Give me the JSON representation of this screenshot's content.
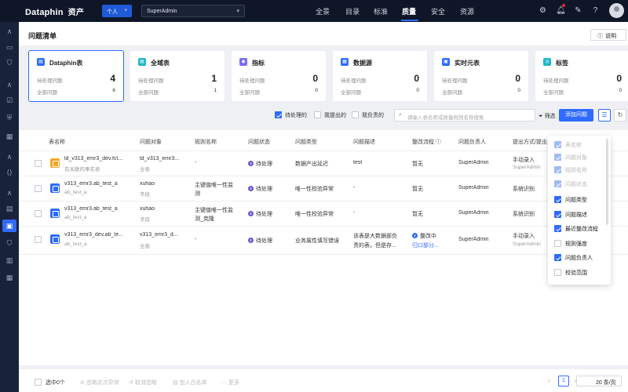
{
  "topbar": {
    "logo": "Dataphin",
    "logo_sub": "资产",
    "mode": "个人",
    "user_select": "SuperAdmin",
    "nav": [
      "全景",
      "目录",
      "标准",
      "质量",
      "安全",
      "资源"
    ],
    "active_nav": "质量"
  },
  "page": {
    "title": "问题清单",
    "help": "说明"
  },
  "cards": [
    {
      "name": "Dataphin表",
      "pending_label": "待处理问题",
      "pending": "4",
      "total_label": "全部问题",
      "total": "6",
      "color": "#2f6bff"
    },
    {
      "name": "全域表",
      "pending_label": "待处理问题",
      "pending": "1",
      "total_label": "全部问题",
      "total": "1",
      "color": "#20b6c8"
    },
    {
      "name": "指标",
      "pending_label": "待处理问题",
      "pending": "0",
      "total_label": "全部问题",
      "total": "0",
      "color": "#7b6cf6"
    },
    {
      "name": "数据源",
      "pending_label": "待处理问题",
      "pending": "0",
      "total_label": "全部问题",
      "total": "0",
      "color": "#2f6bff"
    },
    {
      "name": "实时元表",
      "pending_label": "待处理问题",
      "pending": "0",
      "total_label": "全部问题",
      "total": "0",
      "color": "#2f6bff"
    },
    {
      "name": "标签",
      "pending_label": "待处理问题",
      "pending": "0",
      "total_label": "全部问题",
      "total": "0",
      "color": "#20b6c8"
    }
  ],
  "filters": {
    "pending": "待处理的",
    "mine_raised": "我提出的",
    "mine_owned": "我负责的",
    "search_placeholder": "请输入表名称或质量规则名称搜索",
    "filter": "筛选",
    "add": "添加问题"
  },
  "table": {
    "headers": [
      "表名称",
      "问题对象",
      "规则名称",
      "问题状态",
      "问题类型",
      "问题描述",
      "整改流程",
      "问题负责人",
      "提出方式/提出"
    ],
    "rows": [
      {
        "name": "ld_v313_emr3_dev.fct...",
        "sub": "有关联的事实表",
        "object": "ld_v313_emr3...",
        "object_sub": "全表",
        "rule": "-",
        "rule2": "",
        "status": "待处理",
        "type": "数据产出延迟",
        "desc": "test",
        "desc2": "",
        "flow": "暂无",
        "flow2": "",
        "owner": "SuperAdmin",
        "raise": "手动录入",
        "raise2": "SuperAdmin",
        "icon_color": "#f5a623"
      },
      {
        "name": "v313_emr3.ab_test_a",
        "sub": "ab_test_a",
        "object": "xuhao",
        "object_sub": "字段",
        "rule": "主键值唯一性监",
        "rule2": "测",
        "status": "待处理",
        "type": "唯一性校验异常",
        "desc": "-",
        "desc2": "",
        "flow": "暂无",
        "flow2": "",
        "owner": "SuperAdmin",
        "raise": "系统识别",
        "raise2": "",
        "icon_color": "#2f6bff"
      },
      {
        "name": "v313_emr3.ab_test_a",
        "sub": "ab_test_a",
        "object": "xuhao",
        "object_sub": "字段",
        "rule": "主键值唯一性监",
        "rule2": "测_克隆",
        "status": "待处理",
        "type": "唯一性校验异常",
        "desc": "-",
        "desc2": "",
        "flow": "暂无",
        "flow2": "",
        "owner": "SuperAdmin",
        "raise": "系统识别",
        "raise2": "",
        "icon_color": "#2f6bff"
      },
      {
        "name": "v313_emr3_dev.ab_te...",
        "sub": "ab_test_a",
        "object": "v313_emr3_d...",
        "object_sub": "全表",
        "rule": "-",
        "rule2": "",
        "status": "待处理",
        "type": "业务属性填写错误",
        "desc": "该表是大数据部负",
        "desc2": "责的表，但是存...",
        "flow": "整改中",
        "flow2": "归口部分...",
        "owner": "SuperAdmin",
        "raise": "手动录入",
        "raise2": "SuperAdmin",
        "icon_color": "#2f6bff"
      }
    ]
  },
  "columns_dropdown": [
    {
      "label": "表名称",
      "checked": true,
      "disabled": true
    },
    {
      "label": "问题对象",
      "checked": true,
      "disabled": true
    },
    {
      "label": "规则名称",
      "checked": true,
      "disabled": true
    },
    {
      "label": "问题状态",
      "checked": true,
      "disabled": true
    },
    {
      "label": "问题类型",
      "checked": true,
      "disabled": false
    },
    {
      "label": "问题描述",
      "checked": true,
      "disabled": false
    },
    {
      "label": "最近整改流程",
      "checked": true,
      "disabled": false
    },
    {
      "label": "规则强度",
      "checked": false,
      "disabled": false
    },
    {
      "label": "问题负责人",
      "checked": true,
      "disabled": false
    },
    {
      "label": "校验范围",
      "checked": false,
      "disabled": false
    }
  ],
  "footer": {
    "selected": "选中0个",
    "actions": [
      "忽略此次异常",
      "取消忽略",
      "加入白名单",
      "更多"
    ],
    "page": "1",
    "page_size": "20 条/页"
  }
}
